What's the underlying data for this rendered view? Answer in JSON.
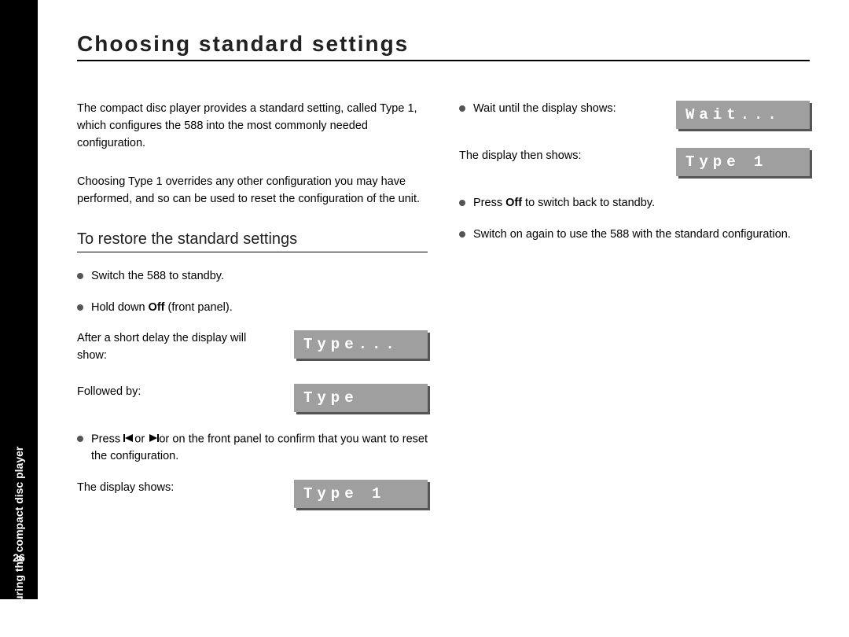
{
  "sidebar": {
    "label": "Configuring the compact disc player",
    "page": "26"
  },
  "title": "Choosing standard settings",
  "col1": {
    "para1": "The compact disc player provides a standard setting, called Type 1, which configures the 588 into the most commonly needed configuration.",
    "para2": "Choosing Type 1 overrides any other configuration you may have performed, and so can be used to reset the configuration of the unit.",
    "subheading": "To restore the standard settings",
    "step1": "Switch the 588 to standby.",
    "step2_pre": "Hold down ",
    "step2_bold": "Off",
    "step2_post": " (front panel).",
    "afterdelay": "After a short delay the display will show:",
    "display1": "Type...",
    "followedby": "Followed by:",
    "display2": "Type",
    "step3_pre": "Press ",
    "step3_mid": "or ",
    "step3_post": "or on the front panel to confirm that you want to reset the configuration.",
    "displayshows": "The display shows:",
    "display3": "Type 1"
  },
  "col2": {
    "wait_text": "Wait until the display shows:",
    "display_wait": "Wait...",
    "then_shows": "The display then shows:",
    "display_type1": "Type 1",
    "step_off_pre": "Press ",
    "step_off_bold": "Off",
    "step_off_post": " to switch back to standby.",
    "step_switch": "Switch on again to use the 588 with the standard configuration."
  }
}
